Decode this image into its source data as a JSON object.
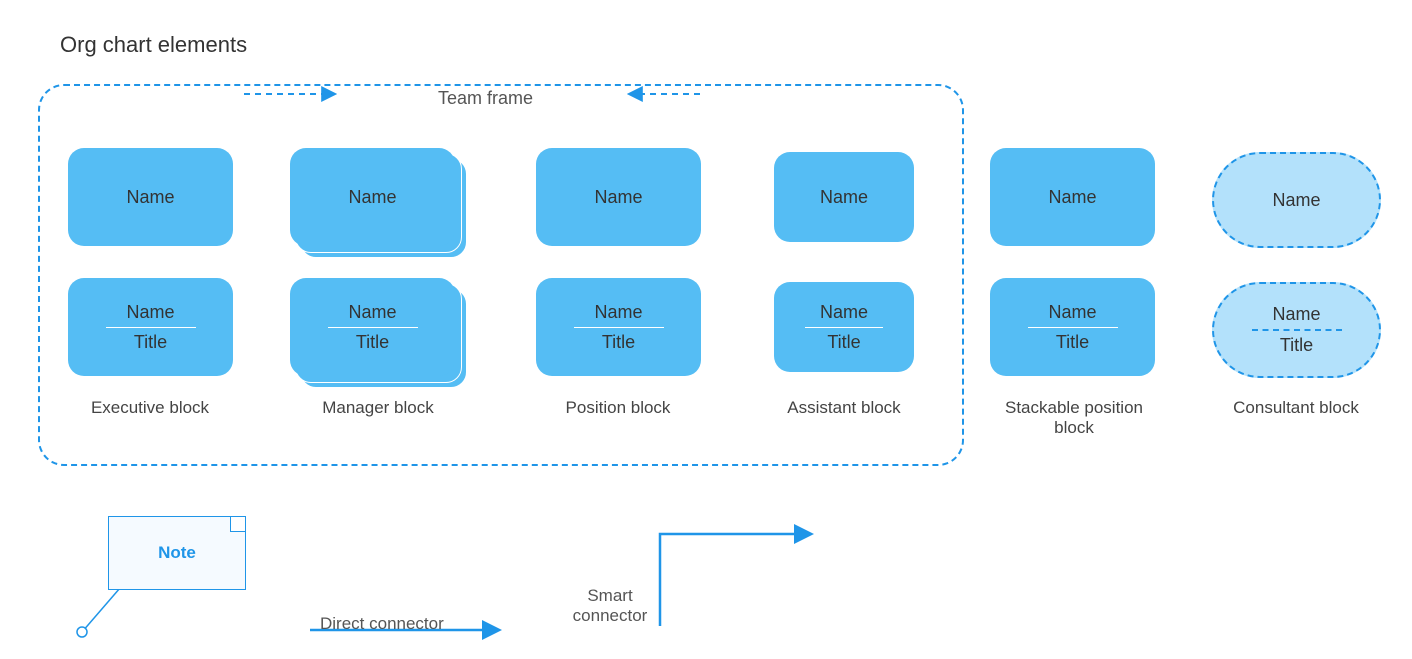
{
  "title": "Org chart elements",
  "teamFrameLabel": "Team frame",
  "name": "Name",
  "titleWord": "Title",
  "captions": {
    "executive": "Executive block",
    "manager": "Manager block",
    "position": "Position block",
    "assistant": "Assistant block",
    "stackable": "Stackable position block",
    "consultant": "Consultant block"
  },
  "note": "Note",
  "directConnector": "Direct connector",
  "smartConnector": "Smart connector"
}
